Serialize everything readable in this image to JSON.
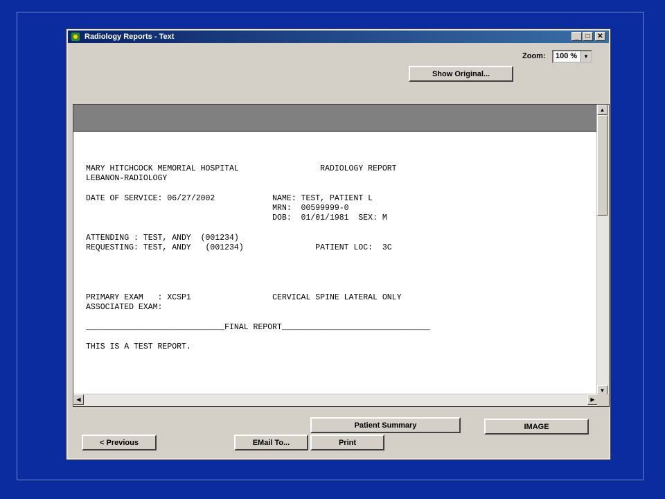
{
  "window": {
    "title": "Radiology Reports - Text"
  },
  "toolbar": {
    "zoom_label": "Zoom:",
    "zoom_value": "100 %",
    "show_original": "Show Original..."
  },
  "report": {
    "lines": [
      "MARY HITCHCOCK MEMORIAL HOSPITAL                 RADIOLOGY REPORT",
      "LEBANON-RADIOLOGY",
      "",
      "DATE OF SERVICE: 06/27/2002            NAME: TEST, PATIENT L",
      "                                       MRN:  00599999-0",
      "                                       DOB:  01/01/1981  SEX: M",
      "",
      "ATTENDING : TEST, ANDY  (001234)",
      "REQUESTING: TEST, ANDY   (001234)               PATIENT LOC:  3C",
      "",
      "",
      "",
      "",
      "PRIMARY EXAM   : XCSP1                 CERVICAL SPINE LATERAL ONLY",
      "ASSOCIATED EXAM:",
      "",
      "_____________________________FINAL REPORT_______________________________",
      "",
      "THIS IS A TEST REPORT."
    ]
  },
  "buttons": {
    "patient_summary": "Patient Summary",
    "image": "IMAGE",
    "previous": "<  Previous",
    "email_to": "EMail To...",
    "print": "Print"
  },
  "icons": {
    "minimize": "minimize-icon",
    "maximize": "maximize-icon",
    "close": "close-icon"
  }
}
